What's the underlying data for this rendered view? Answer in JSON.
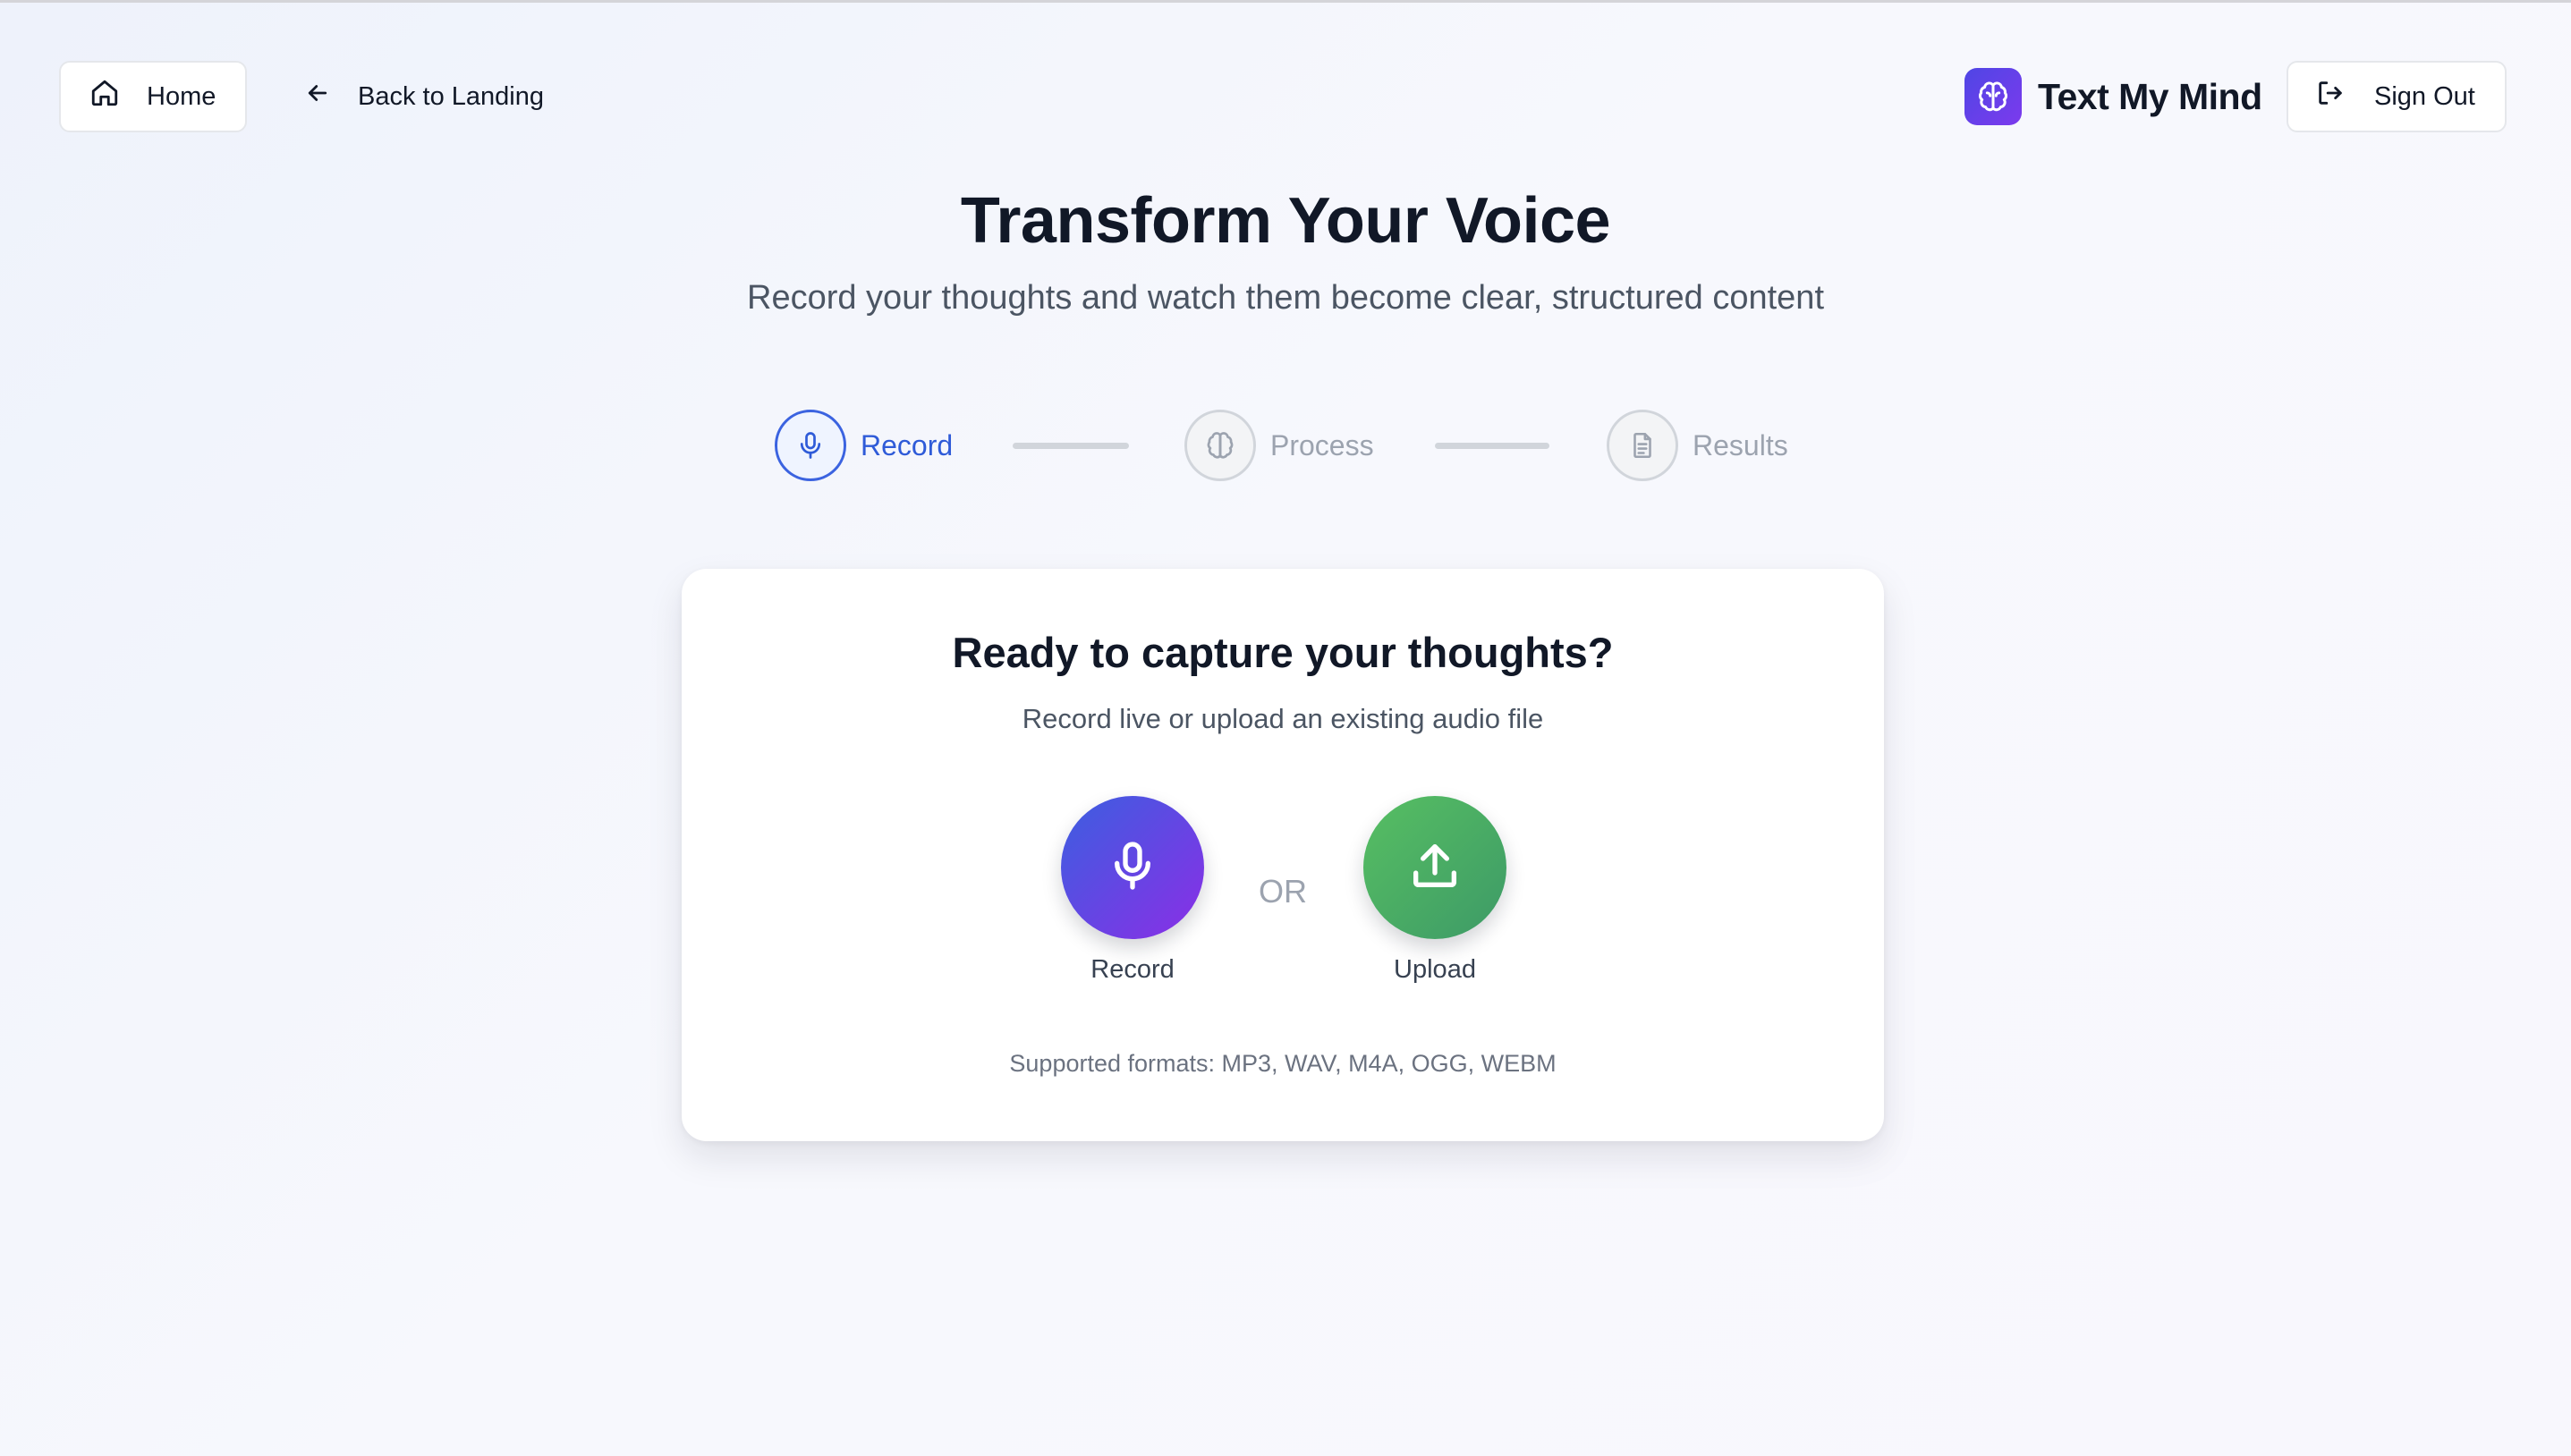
{
  "nav": {
    "home_label": "Home",
    "back_label": "Back to Landing",
    "brand_name": "Text My Mind",
    "signout_label": "Sign Out"
  },
  "hero": {
    "title": "Transform Your Voice",
    "subtitle": "Record your thoughts and watch them become clear, structured content"
  },
  "steps": [
    {
      "label": "Record",
      "icon": "microphone-icon",
      "active": true
    },
    {
      "label": "Process",
      "icon": "brain-icon",
      "active": false
    },
    {
      "label": "Results",
      "icon": "document-icon",
      "active": false
    }
  ],
  "card": {
    "title": "Ready to capture your thoughts?",
    "subtitle": "Record live or upload an existing audio file",
    "record_label": "Record",
    "or_label": "OR",
    "upload_label": "Upload",
    "formats": "Supported formats: MP3, WAV, M4A, OGG, WEBM"
  },
  "colors": {
    "accent_blue": "#2f5bd8",
    "record_gradient": [
      "#3b5fe0",
      "#8b2ee6"
    ],
    "upload_gradient": [
      "#57bf62",
      "#3d9a67"
    ],
    "brand_gradient": [
      "#4f46e5",
      "#7c3aed"
    ]
  }
}
